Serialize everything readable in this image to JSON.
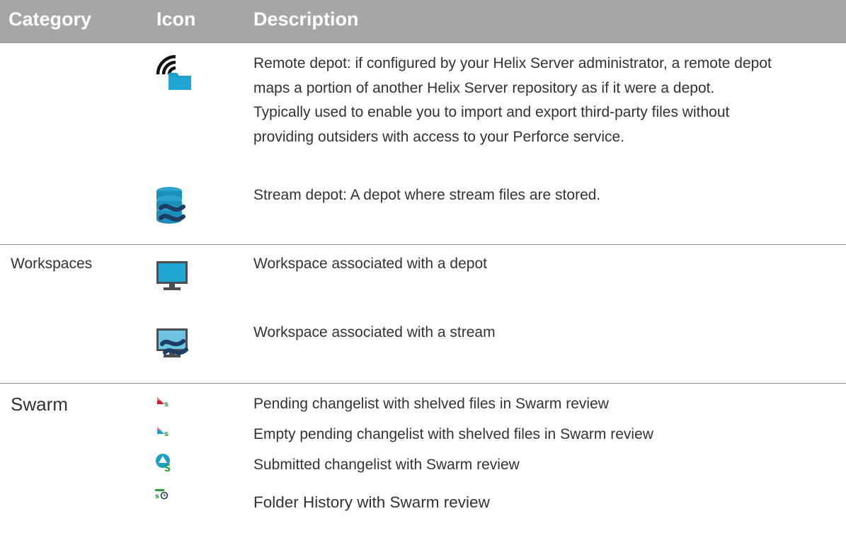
{
  "table": {
    "headers": {
      "category": "Category",
      "icon": "Icon",
      "description": "Description"
    },
    "groups": [
      {
        "category": "",
        "rows": [
          {
            "icon": "remote-depot-icon",
            "description": "Remote depot: if configured by your Helix Server administrator, a remote depot maps a portion of another Helix Server repository as if it were a depot. Typically used to enable you to import and export third-party files without providing outsiders with access to your Perforce service."
          },
          {
            "icon": "stream-depot-icon",
            "description": "Stream depot: A depot where stream files are stored."
          }
        ]
      },
      {
        "category": "Workspaces",
        "rows": [
          {
            "icon": "workspace-depot-icon",
            "description": "Workspace associated with a depot"
          },
          {
            "icon": "workspace-stream-icon",
            "description": "Workspace associated with a stream"
          }
        ]
      },
      {
        "category": "Swarm",
        "rows": [
          {
            "icon": "pending-changelist-swarm-icon",
            "description": "Pending changelist with shelved files in Swarm review"
          },
          {
            "icon": "empty-pending-changelist-swarm-icon",
            "description": "Empty pending changelist with shelved files in Swarm review"
          },
          {
            "icon": "submitted-changelist-swarm-icon",
            "description": "Submitted changelist with Swarm review"
          },
          {
            "icon": "folder-history-swarm-icon",
            "description": "Folder History with Swarm review"
          }
        ]
      }
    ]
  },
  "colors": {
    "header_background": "#a6a6a6",
    "header_text": "#ffffff",
    "body_text": "#333333",
    "separator": "#8a8a8a",
    "icon_teal": "#1b9fc8",
    "icon_navy": "#1d3d63",
    "swarm_red": "#c8202e",
    "swarm_green": "#2f9e3f"
  }
}
